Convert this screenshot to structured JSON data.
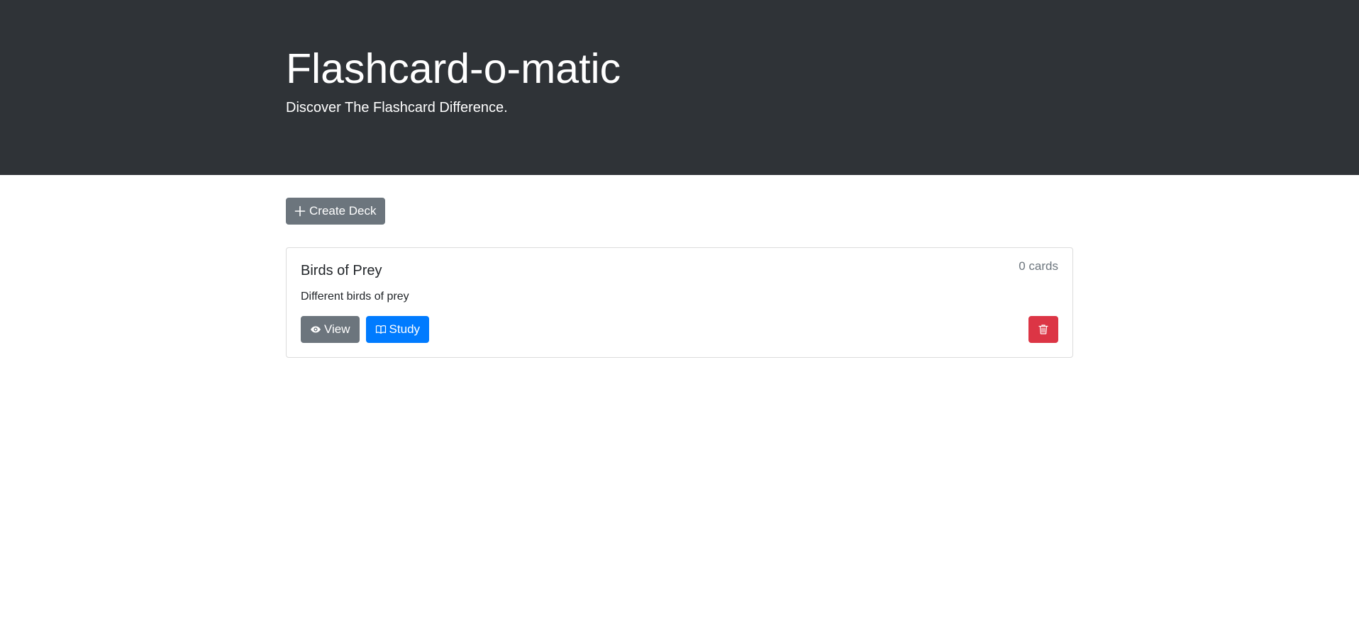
{
  "header": {
    "title": "Flashcard-o-matic",
    "subtitle": "Discover The Flashcard Difference."
  },
  "toolbar": {
    "create_deck_label": "Create Deck"
  },
  "decks": [
    {
      "name": "Birds of Prey",
      "count_label": "0 cards",
      "description": "Different birds of prey",
      "view_label": "View",
      "study_label": "Study"
    }
  ],
  "icons": {
    "create": "plus-icon",
    "view": "eye-icon",
    "study": "book-icon",
    "delete": "trash-icon"
  },
  "colors": {
    "header_bg": "#2f3337",
    "secondary": "#6c757d",
    "primary": "#007bff",
    "danger": "#dc3545"
  }
}
